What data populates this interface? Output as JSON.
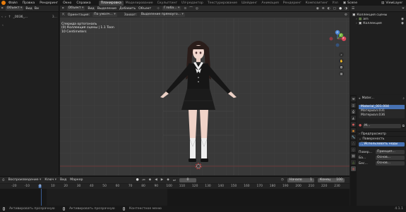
{
  "topbar": {
    "menus": [
      "Файл",
      "Правка",
      "Рендеринг",
      "Окно",
      "Справка"
    ],
    "workspaces": [
      "Планировка",
      "Моделирование",
      "Скульптинг",
      "UV-редактор",
      "Текстурирование",
      "Шейдинг",
      "Анимация",
      "Рендеринг",
      "Композитинг",
      "Узл"
    ],
    "active_workspace": "Планировка",
    "scene": "Scene",
    "view_layer": "ViewLayer"
  },
  "left_panel": {
    "mode": "Объект",
    "menu": [
      "Вид",
      "Ви"
    ],
    "path": "_0036_...",
    "asset": "3..."
  },
  "viewport": {
    "mode": "Объект",
    "menus": [
      "Вид",
      "Выделение",
      "Добавить",
      "Объект"
    ],
    "shading": "Глоба...",
    "orientation_label": "Ориентация:",
    "orientation_value": "По умолч...",
    "snap_label": "Захват:",
    "snap_value": "Выделение прямоуго...",
    "info": [
      "Сперида ортогональ",
      "(0) Коллекция сцены | 1.1 Toon",
      "10 Centimeters"
    ],
    "gizmo": {
      "x": "X",
      "y": "Y",
      "z": "Z"
    }
  },
  "outliner": {
    "title": "Коллекция сцены",
    "items": [
      "arn",
      "Коллекция"
    ]
  },
  "properties": {
    "object": "Mater...",
    "slots": [
      "Material_001.004",
      "Материал.031",
      "Материал.036"
    ],
    "selected_slot": 0,
    "material_field": "M...",
    "sections": [
      "Предпросмотр",
      "Поверхность"
    ],
    "use_nodes_button": "Использовать ноды",
    "props": [
      {
        "label": "Повер...",
        "value": "Принцип..."
      },
      {
        "label": "Ба...",
        "value": "Основ..."
      },
      {
        "label": "Бес...",
        "value": "Основ..."
      }
    ],
    "version": "4.1.1"
  },
  "timeline": {
    "menus": [
      "Воспроизведение",
      "Ключ",
      "Вид",
      "Маркер"
    ],
    "current_frame": "0",
    "start_label": "Начало",
    "start": "1",
    "end_label": "Конец",
    "end": "100",
    "ticks": [
      "-20",
      "-10",
      "0",
      "10",
      "20",
      "30",
      "40",
      "50",
      "60",
      "70",
      "80",
      "90",
      "100",
      "110",
      "120",
      "130",
      "140",
      "150",
      "160",
      "170",
      "180",
      "190",
      "200",
      "210",
      "220",
      "230"
    ]
  },
  "status": {
    "left": "Активировать прозрачную",
    "middle": "Активировать прозрачную",
    "right": "Контекстное меню"
  },
  "colors": {
    "accent": "#4772b3",
    "blender_orange": "#e87d0d",
    "x_axis": "#e0475a",
    "y_axis": "#74b63c",
    "z_axis": "#4d87d7"
  }
}
